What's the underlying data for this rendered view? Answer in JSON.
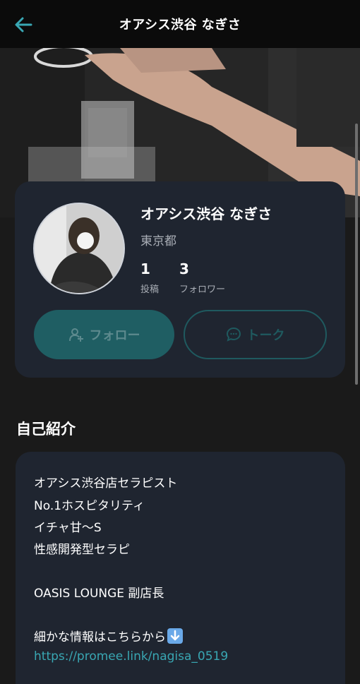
{
  "header": {
    "title": "オアシス渋谷 なぎさ"
  },
  "profile": {
    "name": "オアシス渋谷 なぎさ",
    "location": "東京都",
    "stats": [
      {
        "value": "1",
        "label": "投稿"
      },
      {
        "value": "3",
        "label": "フォロワー"
      }
    ],
    "follow_label": "フォロー",
    "talk_label": "トーク"
  },
  "bio": {
    "title": "自己紹介",
    "lines": [
      "オアシス渋谷店セラピスト",
      "No.1ホスピタリティ",
      "イチャ甘〜S",
      "性感開発型セラピ",
      "OASIS LOUNGE 副店長",
      "細かな情報はこちらから"
    ],
    "link": "https://promee.link/nagisa_0519"
  },
  "colors": {
    "accent": "#39a7b3",
    "card_bg": "#1f2530",
    "page_bg": "#1a1a1a",
    "follow_btn_bg": "#1f5e63"
  },
  "icons": [
    "back-arrow-icon",
    "add-user-icon",
    "chat-bubble-icon",
    "down-arrow-emoji-icon"
  ]
}
